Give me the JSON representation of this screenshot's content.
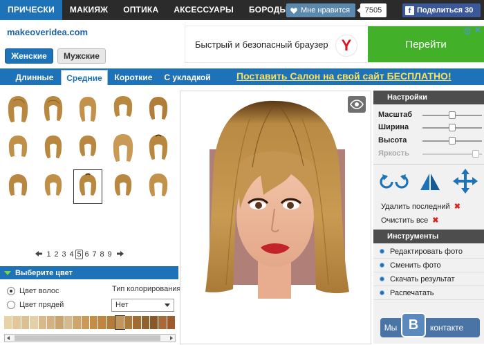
{
  "nav": {
    "items": [
      "ПРИЧЕСКИ",
      "МАКИЯЖ",
      "ОПТИКА",
      "АКСЕССУАРЫ",
      "БОРОДЫ"
    ],
    "like_label": "Мне нравится",
    "like_count": "7505",
    "fb_logo": "f",
    "fb_label": "Поделиться 30"
  },
  "header": {
    "site_name": "makeoveridea.com",
    "female_label": "Женские",
    "male_label": "Мужские"
  },
  "ad": {
    "text": "Быстрый и безопасный браузер",
    "logo": "Y",
    "cta": "Перейти"
  },
  "tabs": {
    "items": [
      "Длинные",
      "Средние",
      "Короткие",
      "С укладкой"
    ],
    "promo": "Поставить Салон на свой сайт БЕСПЛАТНО!"
  },
  "pager": {
    "pages": [
      "1",
      "2",
      "3",
      "4",
      "5",
      "6",
      "7",
      "8",
      "9"
    ],
    "current": "5"
  },
  "color": {
    "title": "Выберите цвет",
    "hair_color": "Цвет волос",
    "strands_color": "Цвет прядей",
    "type_label": "Тип колорирования",
    "select_value": "Нет",
    "swatches": [
      "#e8d3a6",
      "#e2c79b",
      "#dcc092",
      "#e5cfa8",
      "#d8b989",
      "#d2b183",
      "#c9a471",
      "#d6ba8d",
      "#cfa56b",
      "#c99a5a",
      "#c48d48",
      "#bf8541",
      "#b67b36",
      "#c2965b",
      "#ad7a3e",
      "#a06b34",
      "#93602e",
      "#8b5628",
      "#a86a38",
      "#9c5a2e"
    ]
  },
  "panel": {
    "settings_title": "Настройки",
    "sliders": [
      {
        "label": "Масштаб",
        "value": 0.5,
        "enabled": true
      },
      {
        "label": "Ширина",
        "value": 0.5,
        "enabled": true
      },
      {
        "label": "Высота",
        "value": 0.5,
        "enabled": true
      },
      {
        "label": "Яркость",
        "value": 0.95,
        "enabled": false
      }
    ],
    "delete_last": "Удалить последний",
    "clear_all": "Очистить все",
    "x_mark": "✖",
    "tools_title": "Инструменты",
    "tools": [
      "Редактировать фото",
      "Сменить фото",
      "Скачать результат",
      "Распечатать"
    ]
  },
  "vk": {
    "left": "Мы",
    "logo": "B",
    "right": "контакте"
  },
  "colors": {
    "accent": "#1d72b8",
    "hair": "#b98840",
    "dark_bar": "#2b2b2b"
  }
}
